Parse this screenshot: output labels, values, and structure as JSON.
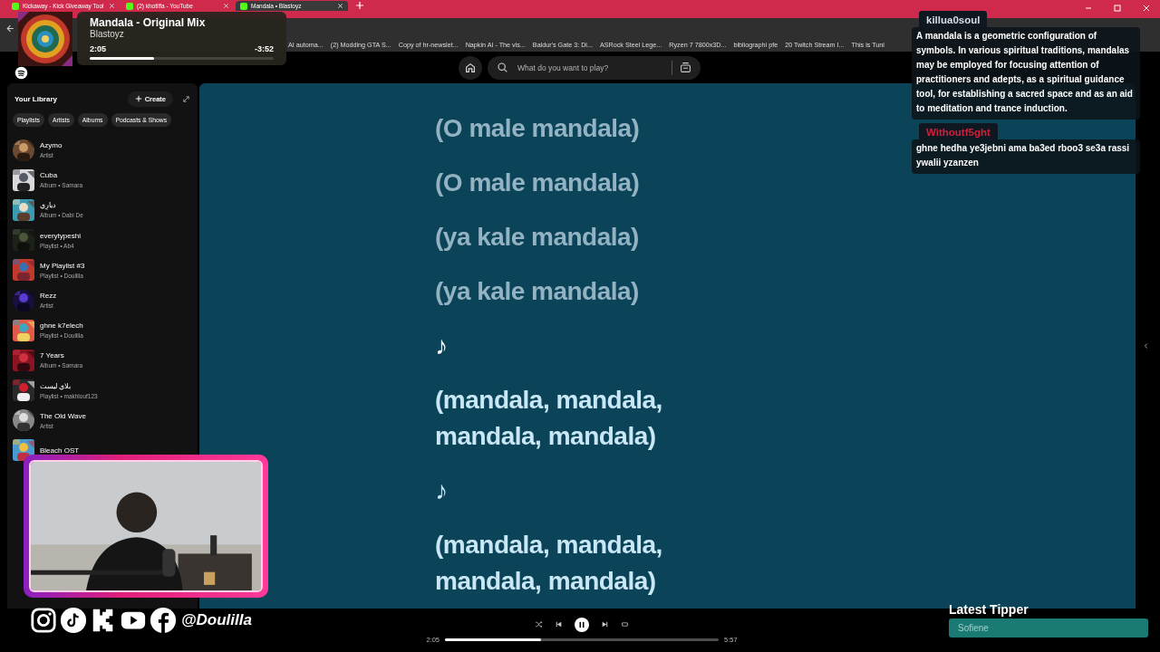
{
  "browser": {
    "tabs": [
      {
        "title": "Kickaway - Kick Giveaway Tool",
        "selected": false
      },
      {
        "title": "(2) khotiffa - YouTube",
        "selected": false
      },
      {
        "title": "Mandala • Blastoyz",
        "selected": true
      }
    ],
    "bookmarks": [
      "AI automa...",
      "(2) Modding GTA S...",
      "Copy of hr-newslet...",
      "Napkin AI - The vis...",
      "Baldur's Gate 3: Di...",
      "ASRock Steel Lege...",
      "Ryzen 7 7800x3D...",
      "bibliographi pfe",
      "20 Twitch Stream I...",
      "This is Tuni"
    ]
  },
  "now_playing_toast": {
    "title": "Mandala - Original Mix",
    "artist": "Blastoyz",
    "elapsed": "2:05",
    "remaining": "-3:52",
    "level": 0.35
  },
  "search": {
    "placeholder": "What do you want to play?"
  },
  "library": {
    "title": "Your Library",
    "create": "Create",
    "filters": [
      "Playlists",
      "Artists",
      "Albums",
      "Podcasts & Shows"
    ],
    "items": [
      {
        "name": "Azymo",
        "subtitle": "Artist",
        "kind": "artist"
      },
      {
        "name": "Cuba",
        "subtitle": "Album • Samara",
        "kind": "album"
      },
      {
        "name": "ديارِي",
        "subtitle": "Album • Dabi De",
        "kind": "album"
      },
      {
        "name": "everytypeshi",
        "subtitle": "Playlist • Ab4",
        "kind": "album"
      },
      {
        "name": "My Playlist #3",
        "subtitle": "Playlist • Doulilla",
        "kind": "album"
      },
      {
        "name": "Rezz",
        "subtitle": "Artist",
        "kind": "artist"
      },
      {
        "name": "ghne k7elech",
        "subtitle": "Playlist • Doulilla",
        "kind": "album"
      },
      {
        "name": "7 Years",
        "subtitle": "Album • Samara",
        "kind": "album"
      },
      {
        "name": "بلاي ليست",
        "subtitle": "Playlist • makhlouf123",
        "kind": "album"
      },
      {
        "name": "The Old Wave",
        "subtitle": "Artist",
        "kind": "artist"
      },
      {
        "name": "Bleach OST",
        "kind": "album"
      }
    ]
  },
  "lyrics": [
    {
      "text": "(O male mandala)",
      "past": true,
      "active": false
    },
    {
      "text": "(O male mandala)",
      "past": true,
      "active": false
    },
    {
      "text": "(ya kale mandala)",
      "past": true,
      "active": false
    },
    {
      "text": "(ya kale mandala)",
      "past": true,
      "active": false
    },
    {
      "text": "♪",
      "past": false,
      "active": true
    },
    {
      "text": "(mandala, mandala, mandala, mandala)",
      "past": false,
      "active": false
    },
    {
      "text": "♪",
      "past": false,
      "active": false
    },
    {
      "text": "(mandala, mandala, mandala, mandala)",
      "past": false,
      "active": false
    }
  ],
  "player": {
    "elapsed": "2:05",
    "total": "5:57",
    "level": 0.35
  },
  "chat": [
    {
      "user": "killua0soul",
      "color": "#d8dde8",
      "message": "A mandala is a geometric configuration of symbols. In various spiritual traditions, mandalas may be employed for focusing attention of practitioners and adepts, as a spiritual guidance tool, for establishing a sacred space and as an aid to meditation and trance induction."
    },
    {
      "user": "Withoutf5ght",
      "color": "#d0203c",
      "message": "ghne hedha ye3jebni ama ba3ed rboo3 se3a rassi ywalii yzanzen"
    }
  ],
  "socials": {
    "handle": "@Doulilla"
  },
  "latest_tipper": {
    "title": "Latest Tipper",
    "name": "Sofiene"
  }
}
